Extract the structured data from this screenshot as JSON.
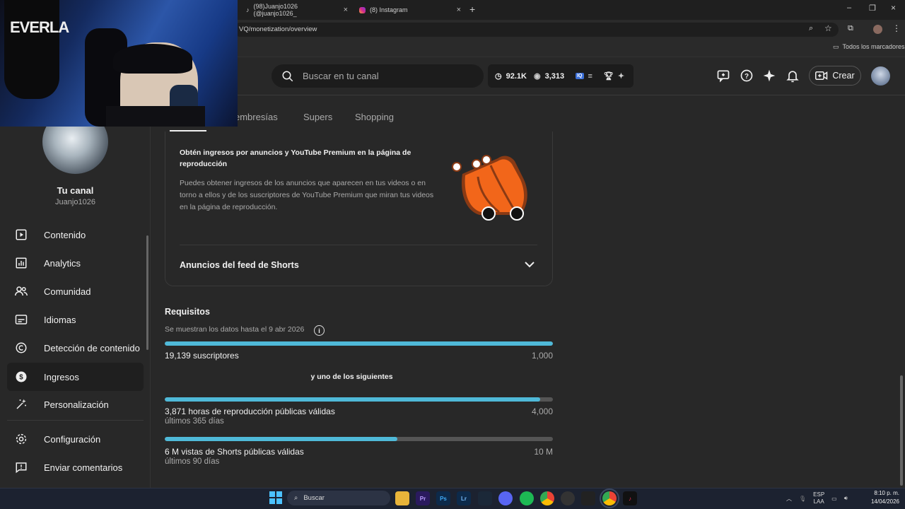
{
  "browser": {
    "tabs": [
      {
        "title": "(98)Juanjo1026 (@juanjo1026_"
      },
      {
        "title": "(8) Instagram"
      }
    ],
    "url": "VQ/monetization/overview",
    "bookmarks_folder": "Todos los marcadores"
  },
  "header": {
    "search_placeholder": "Buscar en tu canal",
    "stats": {
      "views_time": "92.1K",
      "live_viewers": "3,313"
    },
    "create_label": "Crear"
  },
  "sidebar": {
    "channel_title": "Tu canal",
    "channel_handle": "Juanjo1026",
    "items": [
      {
        "label": "Contenido",
        "icon": "video-icon"
      },
      {
        "label": "Analytics",
        "icon": "chart-icon"
      },
      {
        "label": "Comunidad",
        "icon": "people-icon"
      },
      {
        "label": "Idiomas",
        "icon": "subtitles-icon"
      },
      {
        "label": "Detección de contenido",
        "icon": "copyright-icon"
      },
      {
        "label": "Ingresos",
        "icon": "dollar-icon",
        "active": true
      },
      {
        "label": "Personalización",
        "icon": "magic-wand-icon"
      }
    ],
    "bottom_items": [
      {
        "label": "Configuración",
        "icon": "gear-icon"
      },
      {
        "label": "Enviar comentarios",
        "icon": "feedback-icon"
      }
    ]
  },
  "tabs": [
    "embresías",
    "Supers",
    "Shopping"
  ],
  "card": {
    "title": "Obtén ingresos por anuncios y YouTube Premium en la página de reproducción",
    "body": "Puedes obtener ingresos de los anuncios que aparecen en tus videos o en torno a ellos y de los suscriptores de YouTube Premium que miran tus videos en la página de reproducción.",
    "shorts_section": "Anuncios del feed de Shorts"
  },
  "requirements": {
    "title": "Requisitos",
    "note": "Se muestran los datos hasta el 9 abr 2026",
    "or_text": "y uno de los siguientes",
    "items": [
      {
        "label": "19,139 suscriptores",
        "target": "1,000",
        "progress": 1.0,
        "sub": ""
      },
      {
        "label": "3,871 horas de reproducción públicas válidas",
        "target": "4,000",
        "progress": 0.968,
        "sub": "últimos 365 días"
      },
      {
        "label": "6 M vistas de Shorts públicas válidas",
        "target": "10 M",
        "progress": 0.6,
        "sub": "últimos 90 días"
      }
    ]
  },
  "taskbar": {
    "search_label": "Buscar",
    "apps": [
      "Pr",
      "Ps",
      "Lr"
    ],
    "lang": "ESP",
    "lang2": "LAA",
    "time": "8:10 p. m.",
    "date": "14/04/2026"
  },
  "colors": {
    "progress": "#4fb9d8",
    "accent_orange": "#f2661a"
  }
}
